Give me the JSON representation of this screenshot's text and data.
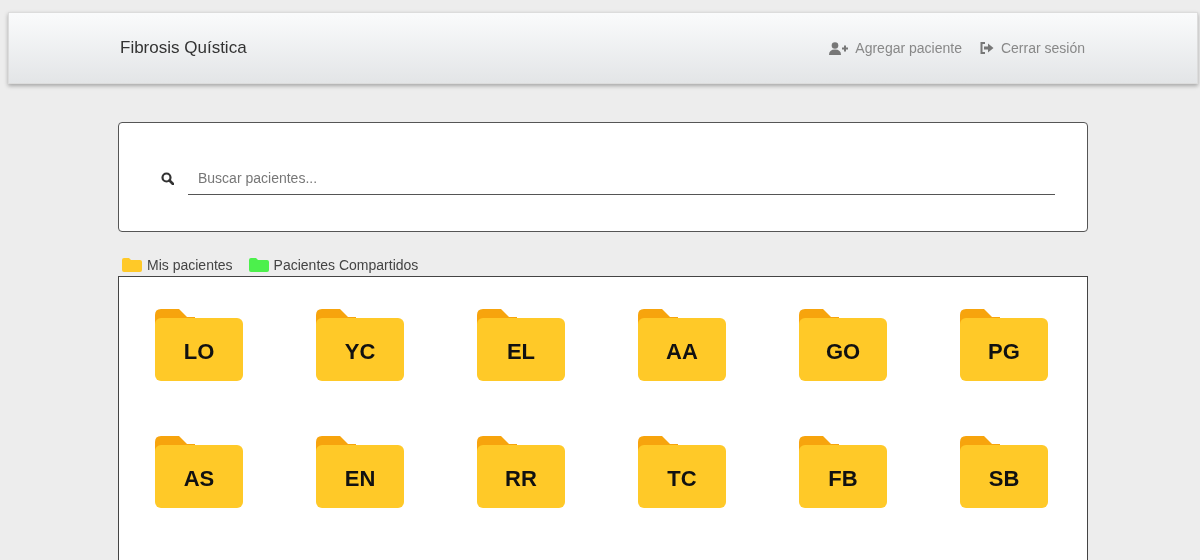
{
  "navbar": {
    "title": "Fibrosis Quística",
    "actions": [
      {
        "kind": "add-user",
        "label": "Agregar paciente"
      },
      {
        "kind": "logout",
        "label": "Cerrar sesión"
      }
    ]
  },
  "search": {
    "placeholder": "Buscar pacientes..."
  },
  "legend": [
    {
      "label": "Mis pacientes",
      "color": "#ffc928"
    },
    {
      "label": "Pacientes Compartidos",
      "color": "#4cf04c"
    }
  ],
  "patients": [
    {
      "initials": "LO",
      "color": "#ffc928"
    },
    {
      "initials": "YC",
      "color": "#ffc928"
    },
    {
      "initials": "EL",
      "color": "#ffc928"
    },
    {
      "initials": "AA",
      "color": "#ffc928"
    },
    {
      "initials": "GO",
      "color": "#ffc928"
    },
    {
      "initials": "PG",
      "color": "#ffc928"
    },
    {
      "initials": "AS",
      "color": "#ffc928"
    },
    {
      "initials": "EN",
      "color": "#ffc928"
    },
    {
      "initials": "RR",
      "color": "#ffc928"
    },
    {
      "initials": "TC",
      "color": "#ffc928"
    },
    {
      "initials": "FB",
      "color": "#ffc928"
    },
    {
      "initials": "SB",
      "color": "#ffc928"
    }
  ]
}
